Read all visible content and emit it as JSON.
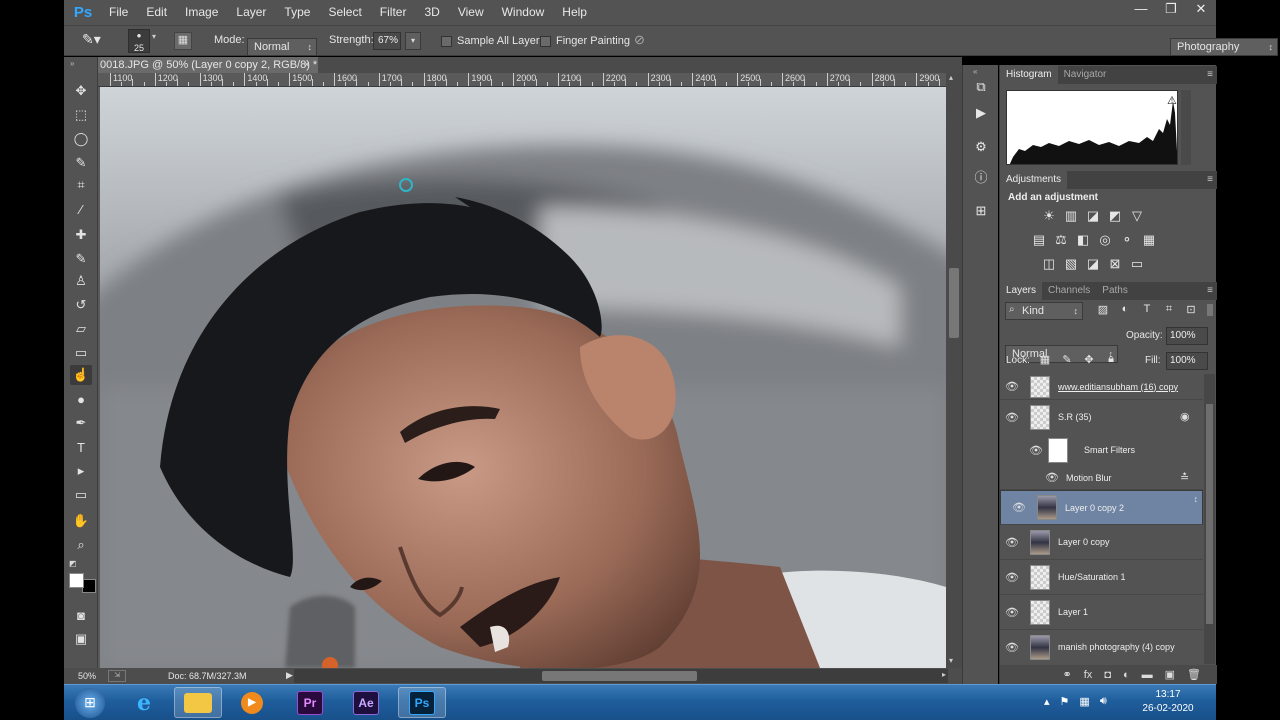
{
  "app": {
    "logo": "Ps",
    "window_controls": [
      "—",
      "❐",
      "✕"
    ]
  },
  "menu": [
    "File",
    "Edit",
    "Image",
    "Layer",
    "Type",
    "Select",
    "Filter",
    "3D",
    "View",
    "Window",
    "Help"
  ],
  "options_bar": {
    "brush_size": "25",
    "mode_label": "Mode:",
    "mode_value": "Normal",
    "strength_label": "Strength:",
    "strength_value": "67%",
    "sample_all_layers": "Sample All Layers",
    "finger_painting": "Finger Painting",
    "workspace": "Photography"
  },
  "document": {
    "tab_title": "0018.JPG @ 50% (Layer 0 copy 2, RGB/8) *",
    "close": "×",
    "ruler_ticks": [
      "1100",
      "1200",
      "1300",
      "1400",
      "1500",
      "1600",
      "1700",
      "1800",
      "1900",
      "2000",
      "2100",
      "2200",
      "2300",
      "2400",
      "2500",
      "2600",
      "2700",
      "2800",
      "2900"
    ]
  },
  "status_bar": {
    "zoom": "50%",
    "doc_size": "Doc: 68.7M/327.3M"
  },
  "panels": {
    "histogram_tabs": [
      "Histogram",
      "Navigator"
    ],
    "adjustments_tab": "Adjustments",
    "adjustments_title": "Add an adjustment",
    "layers_tabs": [
      "Layers",
      "Channels",
      "Paths"
    ],
    "filter_kind": "Kind",
    "blend_mode": "Normal",
    "opacity_label": "Opacity:",
    "opacity_value": "100%",
    "lock_label": "Lock:",
    "fill_label": "Fill:",
    "fill_value": "100%"
  },
  "layers": [
    {
      "name": "www.editiansubham (16) copy",
      "thumb": "checker",
      "selected": false
    },
    {
      "name": "S.R (35)",
      "thumb": "checker",
      "selected": false
    },
    {
      "name": "Smart Filters",
      "thumb": "white",
      "selected": false
    },
    {
      "name": "Motion Blur",
      "thumb": "none",
      "selected": false
    },
    {
      "name": "Layer 0 copy 2",
      "thumb": "photo",
      "selected": true
    },
    {
      "name": "Layer 0 copy",
      "thumb": "photo",
      "selected": false
    },
    {
      "name": "Hue/Saturation 1",
      "thumb": "checker",
      "selected": false
    },
    {
      "name": "Layer 1",
      "thumb": "checker",
      "selected": false
    },
    {
      "name": "manish photography (4) copy",
      "thumb": "photo",
      "selected": false
    }
  ],
  "taskbar": {
    "apps": [
      "Start",
      "Internet Explorer",
      "File Explorer",
      "Media Player",
      "Pr",
      "Ae",
      "Ps"
    ],
    "time": "13:17",
    "date": "26-02-2020"
  },
  "colors": {
    "ui_panel": "#535353",
    "selected_layer": "#6f84a3",
    "ps_blue": "#31a8ff",
    "taskbar": "#1f5e9c"
  }
}
